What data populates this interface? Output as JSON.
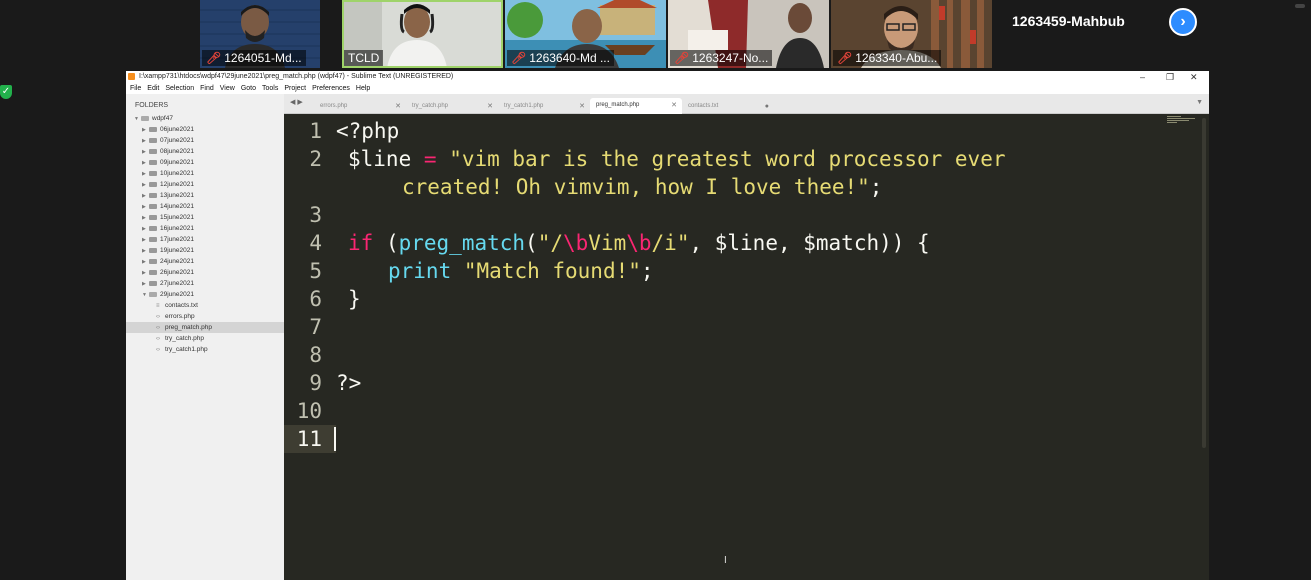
{
  "zoom": {
    "participants": [
      {
        "name": "1264051-Md...",
        "muted": true
      },
      {
        "name": "TCLD",
        "muted": false
      },
      {
        "name": "1263640-Md ...",
        "muted": true
      },
      {
        "name": "1263247-No...",
        "muted": true
      },
      {
        "name": "1263340-Abu...",
        "muted": true
      }
    ],
    "self_name": "1263459-Mahbub",
    "next_icon": "chevron-right-icon"
  },
  "window": {
    "title": "I:\\xampp731\\htdocs\\wdpf47\\29june2021\\preg_match.php (wdpf47) - Sublime Text (UNREGISTERED)",
    "controls": {
      "minimize": "–",
      "restore": "❐",
      "close": "✕"
    }
  },
  "menu": [
    "File",
    "Edit",
    "Selection",
    "Find",
    "View",
    "Goto",
    "Tools",
    "Project",
    "Preferences",
    "Help"
  ],
  "sidebar": {
    "header": "FOLDERS",
    "root": "wdpf47",
    "folders": [
      "06june2021",
      "07june2021",
      "08june2021",
      "09june2021",
      "10june2021",
      "12june2021",
      "13june2021",
      "14june2021",
      "15june2021",
      "16june2021",
      "17june2021",
      "19june2021",
      "24june2021",
      "26june2021",
      "27june2021"
    ],
    "open_folder": "29june2021",
    "files": [
      "contacts.txt",
      "errors.php",
      "preg_match.php",
      "try_catch.php",
      "try_catch1.php"
    ],
    "selected_file": "preg_match.php"
  },
  "tabs": [
    {
      "label": "errors.php",
      "close": "✕",
      "active": false
    },
    {
      "label": "try_catch.php",
      "close": "✕",
      "active": false
    },
    {
      "label": "try_catch1.php",
      "close": "✕",
      "active": false
    },
    {
      "label": "preg_match.php",
      "close": "✕",
      "active": true
    },
    {
      "label": "contacts.txt",
      "close": "●",
      "active": false
    }
  ],
  "editor": {
    "line_numbers": [
      "1",
      "2",
      "",
      "3",
      "4",
      "5",
      "6",
      "7",
      "8",
      "9",
      "10",
      "11"
    ],
    "current_line": "11",
    "code": {
      "l1": "<?php",
      "l2_var": "$line",
      "l2_eq": "=",
      "l2_str": "\"vim bar is the greatest word processor ever",
      "l2b_str": "created! Oh vimvim, how I love thee!\"",
      "l2b_end": ";",
      "l4_if": "if",
      "l4_paren": "(",
      "l4_fn": "preg_match",
      "l4_open": "(",
      "l4_s1": "\"/",
      "l4_e1": "\\b",
      "l4_s2": "Vim",
      "l4_e2": "\\b",
      "l4_s3": "/i\"",
      "l4_rest": ", $line, $match)) {",
      "l5_print": "print",
      "l5_str": "\"Match found!\"",
      "l5_end": ";",
      "l6": "}",
      "l9": "?>"
    }
  }
}
